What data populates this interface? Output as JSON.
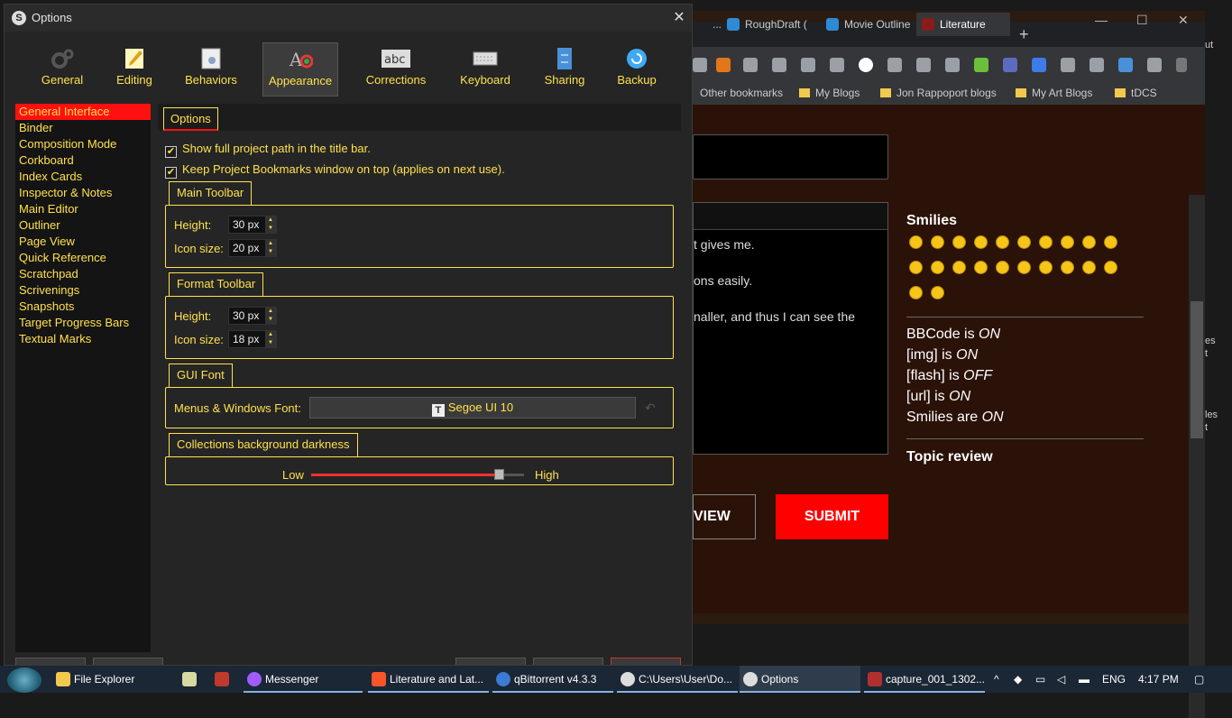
{
  "browser": {
    "tabs": [
      {
        "label": "...ft fr",
        "active": false
      },
      {
        "label": "RoughDraft (",
        "active": false
      },
      {
        "label": "Movie Outline",
        "active": false
      },
      {
        "label": "Literature",
        "active": true
      }
    ],
    "new_tab": "+",
    "window_controls": {
      "minimize": "—",
      "maximize": "☐",
      "close": "✕"
    },
    "bookmarks": [
      "Other bookmarks",
      "My Blogs",
      "Jon Rappoport blogs",
      "My Art Blogs",
      "tDCS"
    ],
    "editor_lines": [
      "t gives me.",
      "ons easily.",
      "naller, and thus I can see the"
    ],
    "preview_label": "VIEW",
    "submit_label": "SUBMIT",
    "smilies_title": "Smilies",
    "bbcode": [
      {
        "prefix": "BBCode is ",
        "state": "ON"
      },
      {
        "prefix": "[img] is ",
        "state": "ON"
      },
      {
        "prefix": "[flash] is ",
        "state": "OFF"
      },
      {
        "prefix": "[url] is ",
        "state": "ON"
      },
      {
        "prefix": "Smilies are ",
        "state": "ON"
      }
    ],
    "topic_review": "Topic review",
    "edge_labels": [
      "ut",
      "es",
      "t",
      "les",
      "t"
    ]
  },
  "dialog": {
    "title": "Options",
    "close_glyph": "✕",
    "toolbar": [
      {
        "label": "General",
        "icon": "gear-icon"
      },
      {
        "label": "Editing",
        "icon": "pencil-icon"
      },
      {
        "label": "Behaviors",
        "icon": "behaviors-icon"
      },
      {
        "label": "Appearance",
        "icon": "appearance-icon"
      },
      {
        "label": "Corrections",
        "icon": "abc-icon"
      },
      {
        "label": "Keyboard",
        "icon": "keyboard-icon"
      },
      {
        "label": "Sharing",
        "icon": "sharing-icon"
      },
      {
        "label": "Backup",
        "icon": "backup-icon"
      }
    ],
    "active_tool": "Appearance",
    "sidebar": [
      "General Interface",
      "Binder",
      "Composition Mode",
      "Corkboard",
      "Index Cards",
      "Inspector & Notes",
      "Main Editor",
      "Outliner",
      "Page View",
      "Quick Reference",
      "Scratchpad",
      "Scrivenings",
      "Snapshots",
      "Target Progress Bars",
      "Textual Marks"
    ],
    "selected_sidebar": "General Interface",
    "options_tab": "Options",
    "checkboxes": [
      {
        "label": "Show full project path in the title bar.",
        "checked": true
      },
      {
        "label": "Keep Project Bookmarks window on top (applies on next use).",
        "checked": true
      }
    ],
    "main_toolbar": {
      "title": "Main Toolbar",
      "height_label": "Height:",
      "height_value": "30 px",
      "icon_label": "Icon size:",
      "icon_value": "20 px"
    },
    "format_toolbar": {
      "title": "Format Toolbar",
      "height_label": "Height:",
      "height_value": "30 px",
      "icon_label": "Icon size:",
      "icon_value": "18 px"
    },
    "gui_font": {
      "title": "GUI Font",
      "label": "Menus & Windows Font:",
      "value": "Segoe UI 10",
      "icon_glyph": "T",
      "reset_glyph": "↶"
    },
    "collections": {
      "title": "Collections background darkness",
      "low": "Low",
      "high": "High",
      "level": 0.88
    }
  },
  "taskbar": {
    "items": [
      {
        "label": "File Explorer",
        "color": "#f2c94c"
      },
      {
        "label": "",
        "color": "#d8d8a0"
      },
      {
        "label": "",
        "color": "#c0392b"
      },
      {
        "label": "Messenger",
        "color": "#a05cff"
      },
      {
        "label": "Literature and Lat...",
        "color": "#fb542b"
      },
      {
        "label": "qBittorrent v4.3.3",
        "color": "#3a7bd5"
      },
      {
        "label": "C:\\Users\\User\\Do...",
        "color": "#dddddd"
      },
      {
        "label": "Options",
        "color": "#dddddd"
      },
      {
        "label": "capture_001_1302...",
        "color": "#b03030"
      }
    ],
    "tray": {
      "chevron": "^",
      "lang": "ENG",
      "time": "4:17 PM"
    }
  }
}
